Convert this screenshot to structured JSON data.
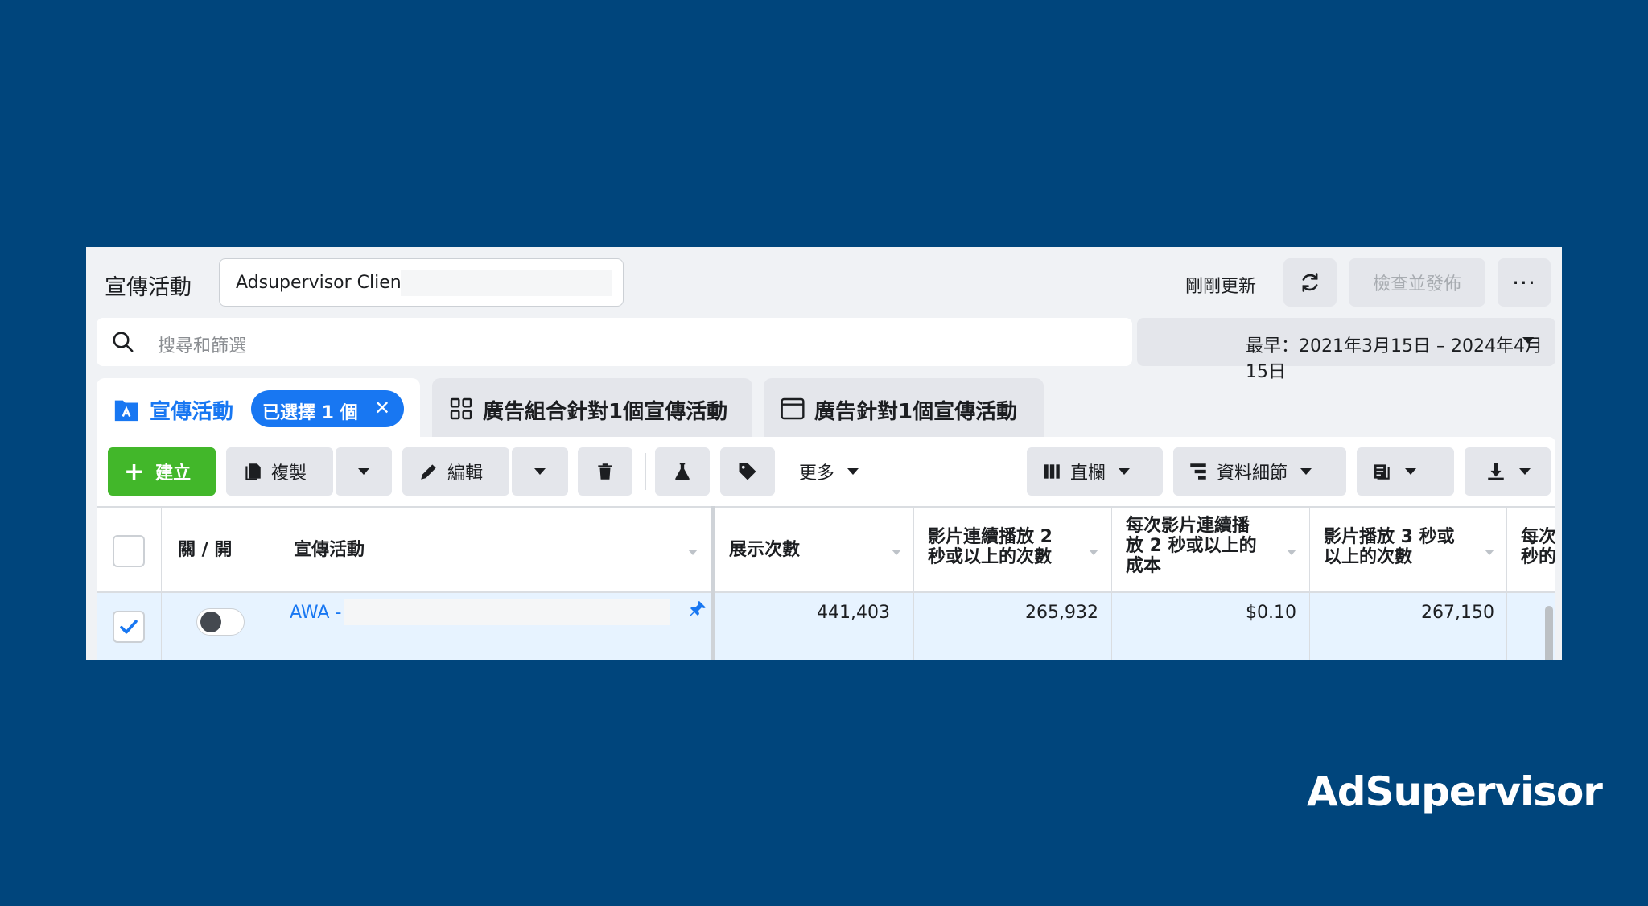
{
  "header": {
    "title": "宣傳活動",
    "account_name": "Adsupervisor Client",
    "updated_label": "剛剛更新",
    "review_publish_label": "檢查並發佈"
  },
  "search": {
    "placeholder": "搜尋和篩選"
  },
  "date_range": {
    "label": "最早：2021年3月15日 – 2024年4月15日"
  },
  "tabs": [
    {
      "label": "宣傳活動",
      "icon": "campaign-icon",
      "selected_chip": "已選擇 1 個"
    },
    {
      "label": "廣告組合針對1個宣傳活動",
      "icon": "grid-icon"
    },
    {
      "label": "廣告針對1個宣傳活動",
      "icon": "window-icon"
    }
  ],
  "toolbar": {
    "create_label": "建立",
    "duplicate_label": "複製",
    "edit_label": "編輯",
    "more_label": "更多",
    "columns_label": "直欄",
    "breakdown_label": "資料細節"
  },
  "table": {
    "headers": {
      "toggle": "關 / 開",
      "campaign": "宣傳活動",
      "impressions": "展示次數",
      "video_2s_line1": "影片連續播放 2",
      "video_2s_line2": "秒或以上的次數",
      "cost_2s_line1": "每次影片連續播",
      "cost_2s_line2": "放 2 秒或以上的",
      "cost_2s_line3": "成本",
      "video_3s_line1": "影片播放 3 秒或",
      "video_3s_line2": "以上的次數",
      "partial_line1": "每次",
      "partial_line2": "秒的"
    },
    "rows": [
      {
        "campaign": "AWA -",
        "impressions": "441,403",
        "video_2s": "265,932",
        "cost_2s": "$0.10",
        "video_3s": "267,150"
      }
    ]
  },
  "brand": {
    "logo_text": "AdSupervisor"
  },
  "colors": {
    "background": "#00457c",
    "accent": "#1877f2",
    "create": "#42b72a"
  }
}
